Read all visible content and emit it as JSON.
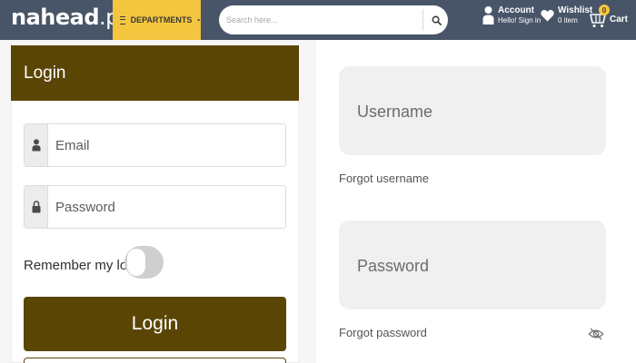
{
  "header": {
    "logo": {
      "main": "nahe",
      "mid": "ad",
      "suffix": ".pk"
    },
    "departments_label": "DEPARTMENTS",
    "search_placeholder": "Search here...",
    "account": {
      "title": "Account",
      "subtitle": "Hello! Sign in"
    },
    "wishlist": {
      "title": "Wishlist",
      "subtitle": "0 item"
    },
    "cart": {
      "title": "Cart",
      "count": "0"
    }
  },
  "login_panel": {
    "heading": "Login",
    "email_placeholder": "Email",
    "password_placeholder": "Password",
    "remember_label": "Remember my login",
    "remember_checked": false,
    "submit_label": "Login"
  },
  "alt_panel": {
    "username_placeholder": "Username",
    "forgot_username": "Forgot username",
    "password_placeholder": "Password",
    "forgot_password": "Forgot password"
  },
  "colors": {
    "header_bg": "#485568",
    "accent_yellow": "#f4c63f",
    "brand_brown": "#5b4505"
  },
  "icons": [
    "menu-icon",
    "search-icon",
    "user-icon",
    "heart-icon",
    "cart-icon",
    "lock-icon",
    "eye-icon"
  ]
}
